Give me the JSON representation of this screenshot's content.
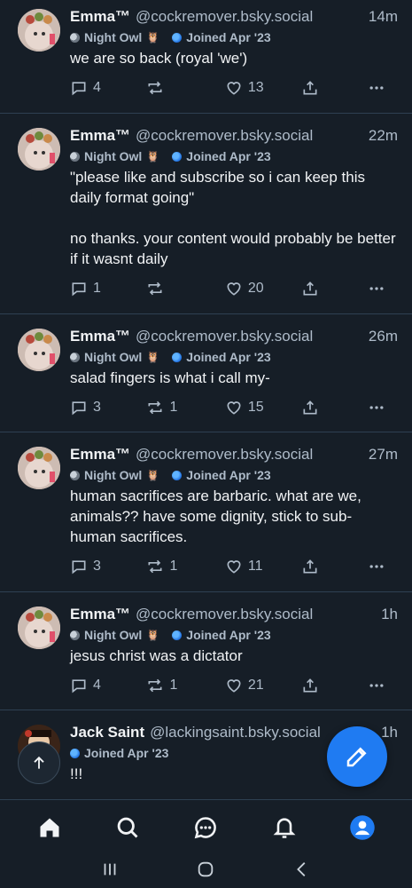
{
  "posts": [
    {
      "name": "Emma™",
      "handle": "@cockremover.bsky.social",
      "time": "14m",
      "badge1": "Night Owl",
      "badge2": "Joined Apr '23",
      "text": "we are so back (royal 'we')",
      "replies": "4",
      "reposts": "",
      "likes": "13"
    },
    {
      "name": "Emma™",
      "handle": "@cockremover.bsky.social",
      "time": "22m",
      "badge1": "Night Owl",
      "badge2": "Joined Apr '23",
      "text": "\"please like and subscribe so i can keep this daily format going\"\n\nno thanks. your content would probably be better if it wasnt daily",
      "replies": "1",
      "reposts": "",
      "likes": "20"
    },
    {
      "name": "Emma™",
      "handle": "@cockremover.bsky.social",
      "time": "26m",
      "badge1": "Night Owl",
      "badge2": "Joined Apr '23",
      "text": "salad fingers is what i call my-",
      "replies": "3",
      "reposts": "1",
      "likes": "15"
    },
    {
      "name": "Emma™",
      "handle": "@cockremover.bsky.social",
      "time": "27m",
      "badge1": "Night Owl",
      "badge2": "Joined Apr '23",
      "text": "human sacrifices are barbaric. what are we, animals?? have some dignity, stick to sub-human sacrifices.",
      "replies": "3",
      "reposts": "1",
      "likes": "11"
    },
    {
      "name": "Emma™",
      "handle": "@cockremover.bsky.social",
      "time": "1h",
      "badge1": "Night Owl",
      "badge2": "Joined Apr '23",
      "text": "jesus christ was a dictator",
      "replies": "4",
      "reposts": "1",
      "likes": "21"
    },
    {
      "name": "Jack Saint",
      "handle": "@lackingsaint.bsky.social",
      "time": "1h",
      "badge1": "",
      "badge2": "Joined Apr '23",
      "text": "!!!",
      "replies": "",
      "reposts": "",
      "likes": ""
    }
  ],
  "colors": {
    "background": "#161e27",
    "accent": "#1f7bf2",
    "muted": "#aebbc9",
    "divider": "#2e4052"
  },
  "icons": {
    "tabs": [
      "home-icon",
      "search-icon",
      "chat-icon",
      "bell-icon",
      "profile-icon"
    ],
    "system": [
      "recent-apps-icon",
      "home-circle-icon",
      "back-icon"
    ]
  }
}
